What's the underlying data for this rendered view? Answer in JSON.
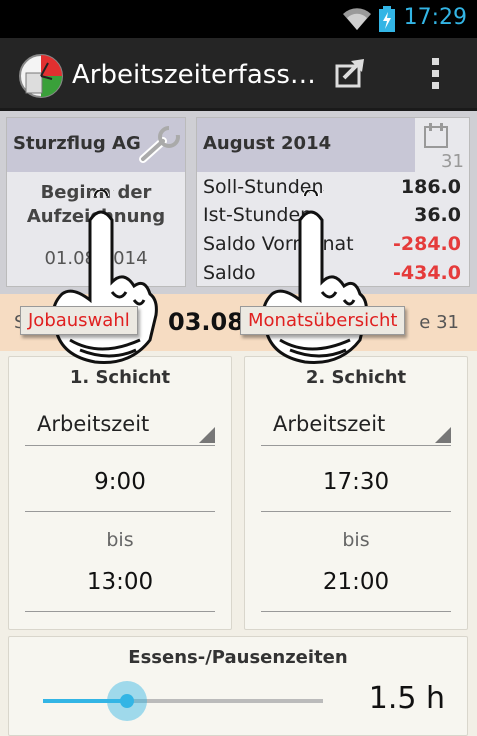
{
  "status_bar": {
    "time": "17:29"
  },
  "action_bar": {
    "title": "Arbeitszeiterfass…",
    "icons": [
      "app-logo-icon",
      "share-icon",
      "overflow-menu-icon"
    ]
  },
  "job_card": {
    "name": "Sturzflug AG",
    "line1": "Beginn der",
    "line2": "Aufzeichnung",
    "date": "01.08.2014"
  },
  "month_card": {
    "title": "August 2014",
    "calendar_day": "31",
    "rows": [
      {
        "label": "Soll-Stunden",
        "value": "186.0"
      },
      {
        "label": "Ist-Stunden",
        "value": "36.0"
      },
      {
        "label": "Saldo Vormonat",
        "value": "-284.0"
      },
      {
        "label": "Saldo",
        "value": "-434.0"
      }
    ]
  },
  "date_bar": {
    "left": "S",
    "date": "03.08.",
    "right": "e 31"
  },
  "shifts": [
    {
      "title": "1. Schicht",
      "type": "Arbeitszeit",
      "from": "9:00",
      "separator": "bis",
      "to": "13:00"
    },
    {
      "title": "2. Schicht",
      "type": "Arbeitszeit",
      "from": "17:30",
      "separator": "bis",
      "to": "21:00"
    }
  ],
  "pause": {
    "title": "Essens-/Pausenzeiten",
    "value": "1.5 h",
    "slider_fraction": 0.3
  },
  "overlays": {
    "tooltip_job": "Jobauswahl",
    "tooltip_month": "Monatsübersicht"
  },
  "colors": {
    "accent": "#33b5e5",
    "negative": "#e53b3b",
    "tooltip_text": "#e02020"
  }
}
